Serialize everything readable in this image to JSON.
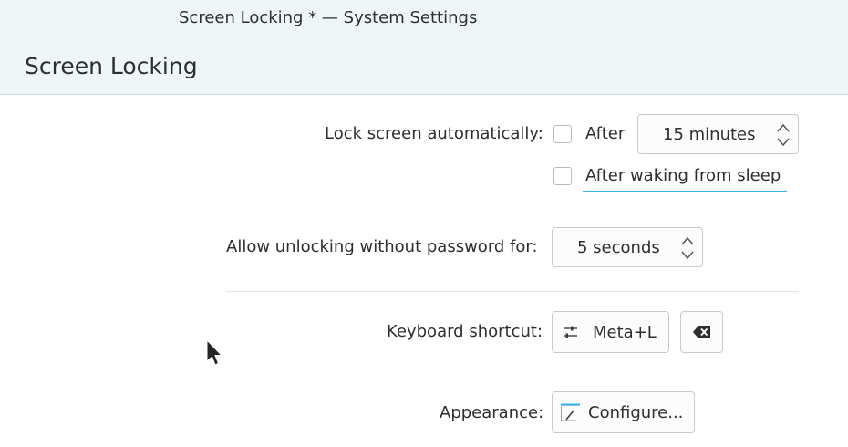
{
  "window": {
    "title": "Screen Locking * — System Settings"
  },
  "page": {
    "title": "Screen Locking"
  },
  "lock": {
    "label": "Lock screen automatically:",
    "after_checked": false,
    "after_label": "After",
    "timeout_value": "15 minutes",
    "after_sleep_checked": false,
    "after_sleep_label": "After waking from sleep"
  },
  "unlock": {
    "label": "Allow unlocking without password for:",
    "value": "5 seconds"
  },
  "shortcut": {
    "label": "Keyboard shortcut:",
    "value": "Meta+L",
    "icon": "configure-shortcut-icon",
    "clear_icon": "backspace-icon"
  },
  "appearance": {
    "label": "Appearance:",
    "button_label": "Configure...",
    "icon": "configure-icon"
  },
  "colors": {
    "accent": "#3daee9",
    "header_bg": "#eff6f6"
  }
}
